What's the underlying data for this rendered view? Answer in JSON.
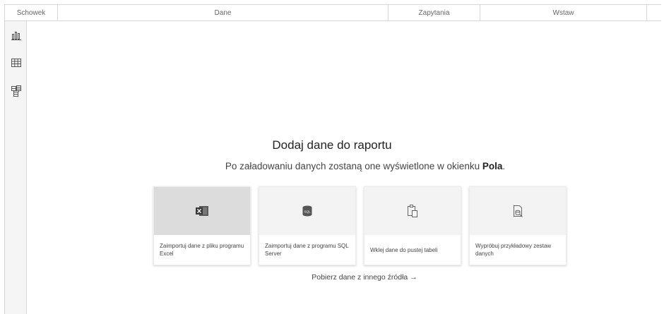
{
  "ribbon": {
    "groups": [
      "Schowek",
      "Dane",
      "Zapytania",
      "Wstaw",
      ""
    ]
  },
  "rail": {
    "views": [
      {
        "name": "report-view",
        "icon": "bar-chart-icon"
      },
      {
        "name": "data-view",
        "icon": "table-grid-icon"
      },
      {
        "name": "model-view",
        "icon": "model-diagram-icon"
      }
    ]
  },
  "canvas": {
    "title": "Dodaj dane do raportu",
    "subtitle_prefix": "Po załadowaniu danych zostaną one wyświetlone w okienku ",
    "subtitle_bold": "Pola",
    "subtitle_suffix": ".",
    "cards": [
      {
        "label": "Zaimportuj dane z pliku programu Excel",
        "icon": "excel-icon"
      },
      {
        "label": "Zaimportuj dane z programu SQL Server",
        "icon": "sql-server-icon"
      },
      {
        "label": "Wklej dane do pustej tabeli",
        "icon": "paste-icon"
      },
      {
        "label": "Wypróbuj przykładowy zestaw danych",
        "icon": "sample-data-icon"
      }
    ],
    "other_source_label": "Pobierz dane z innego źródła",
    "other_source_arrow": "→"
  },
  "colors": {
    "excel_green": "#217346",
    "rail_bg": "#f5f5f5",
    "card_hover_bg": "#dcdcdc"
  }
}
